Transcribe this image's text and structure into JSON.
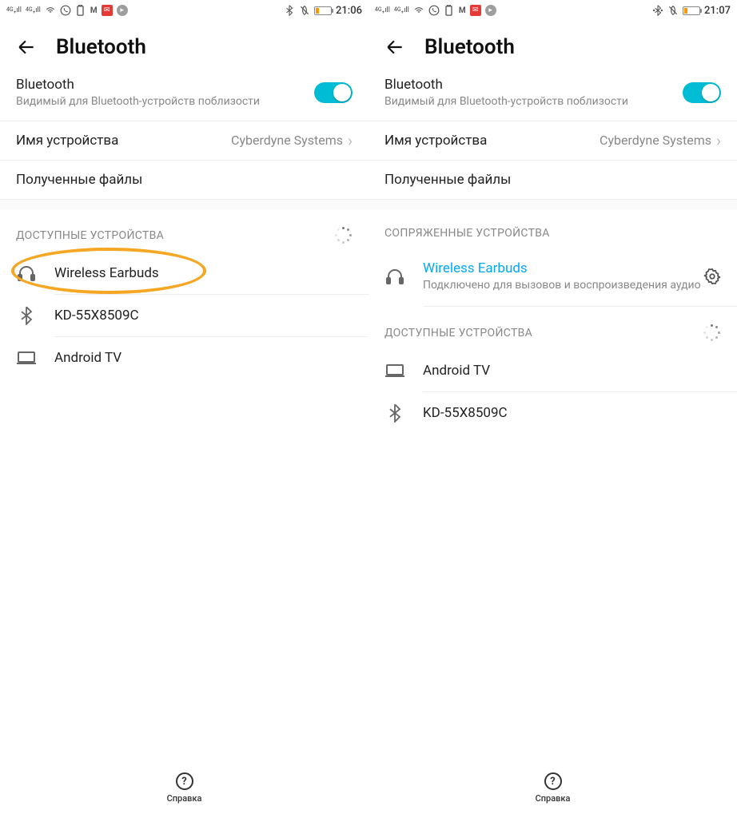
{
  "left": {
    "status": {
      "time": "21:06"
    },
    "header": {
      "title": "Bluetooth"
    },
    "bluetooth": {
      "label": "Bluetooth",
      "sub": "Видимый для Bluetooth-устройств поблизости"
    },
    "device_name": {
      "label": "Имя устройства",
      "value": "Cyberdyne Systems"
    },
    "received": {
      "label": "Полученные файлы"
    },
    "available": {
      "caption": "ДОСТУПНЫЕ УСТРОЙСТВА"
    },
    "devices": [
      {
        "name": "Wireless Earbuds",
        "icon": "headphones"
      },
      {
        "name": "KD-55X8509C",
        "icon": "bluetooth"
      },
      {
        "name": "Android TV",
        "icon": "laptop"
      }
    ],
    "help": "Справка"
  },
  "right": {
    "status": {
      "time": "21:07"
    },
    "header": {
      "title": "Bluetooth"
    },
    "bluetooth": {
      "label": "Bluetooth",
      "sub": "Видимый для Bluetooth-устройств поблизости"
    },
    "device_name": {
      "label": "Имя устройства",
      "value": "Cyberdyne Systems"
    },
    "received": {
      "label": "Полученные файлы"
    },
    "paired": {
      "caption": "СОПРЯЖЕННЫЕ УСТРОЙСТВА",
      "device": {
        "name": "Wireless Earbuds",
        "sub": "Подключено для вызовов и воспроизведения аудио"
      }
    },
    "available": {
      "caption": "ДОСТУПНЫЕ УСТРОЙСТВА",
      "devices": [
        {
          "name": "Android TV",
          "icon": "laptop"
        },
        {
          "name": "KD-55X8509C",
          "icon": "bluetooth"
        }
      ]
    },
    "help": "Справка"
  }
}
